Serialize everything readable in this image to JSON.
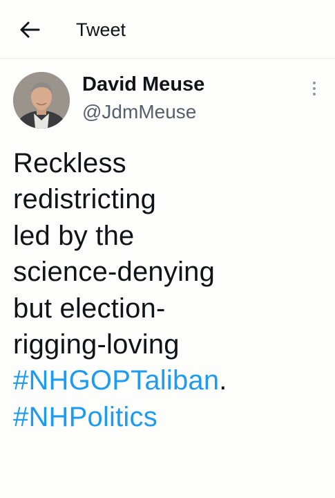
{
  "header": {
    "back_icon": "arrow-left-icon",
    "title": "Tweet"
  },
  "author": {
    "avatar_icon": "avatar-photo",
    "name": "David Meuse",
    "handle": "@JdmMeuse",
    "more_icon": "vertical-ellipsis-icon"
  },
  "tweet": {
    "lines": [
      "Reckless",
      "redistricting",
      "led by the",
      "science-denying",
      "but election-",
      "rigging-loving"
    ],
    "hashtag1": "#NHGOPTaliban",
    "hashtag1_suffix": ".",
    "hashtag2": "#NHPolitics"
  },
  "colors": {
    "background": "#fdfdfb",
    "text": "#0f1419",
    "secondary_text": "#55606a",
    "link": "#1d9bf0"
  }
}
